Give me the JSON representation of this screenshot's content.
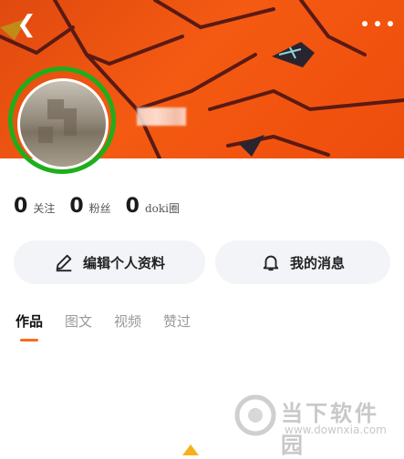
{
  "header": {
    "back_icon": "back-arrow-icon",
    "more_icon": "more-dots-icon"
  },
  "profile": {
    "username_blurred": true
  },
  "stats": [
    {
      "count": "0",
      "label": "关注"
    },
    {
      "count": "0",
      "label": "粉丝"
    },
    {
      "count": "0",
      "label": "doki圈"
    }
  ],
  "actions": {
    "edit_label": "编辑个人资料",
    "messages_label": "我的消息"
  },
  "tabs": [
    {
      "label": "作品",
      "active": true
    },
    {
      "label": "图文",
      "active": false
    },
    {
      "label": "视频",
      "active": false
    },
    {
      "label": "赞过",
      "active": false
    }
  ],
  "watermark": {
    "title": "当下软件园",
    "url": "www.downxia.com"
  },
  "colors": {
    "accent": "#ff6a1a",
    "banner": "#f45a12",
    "highlight_ring": "#1fae1b"
  }
}
